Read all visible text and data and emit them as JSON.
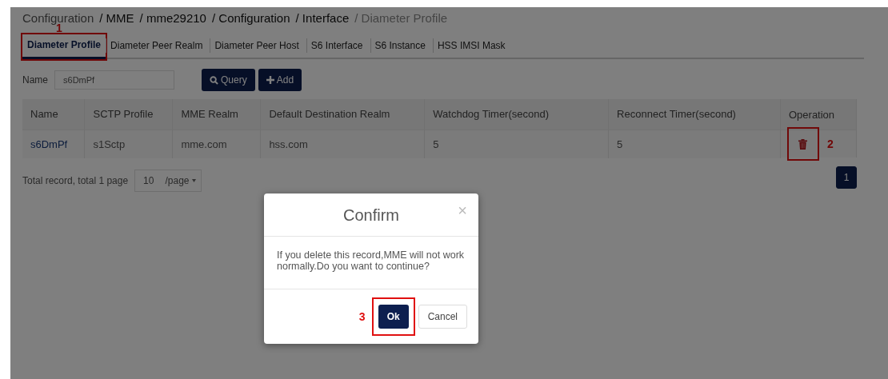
{
  "breadcrumb": [
    {
      "text": "Configuration",
      "current": false
    },
    {
      "text": "/ MME",
      "current": false
    },
    {
      "text": "/ mme29210",
      "current": false
    },
    {
      "text": "/ Configuration",
      "current": false
    },
    {
      "text": "/ Interface",
      "current": false
    },
    {
      "text": "/ Diameter Profile",
      "current": true
    }
  ],
  "tabs": [
    {
      "label": "Diameter Profile",
      "selected": true,
      "callout": "1"
    },
    {
      "label": "Diameter Peer Realm",
      "selected": false
    },
    {
      "label": "Diameter Peer Host",
      "selected": false
    },
    {
      "label": "S6 Interface",
      "selected": false
    },
    {
      "label": "S6 Instance",
      "selected": false
    },
    {
      "label": "HSS IMSI Mask",
      "selected": false
    }
  ],
  "filter": {
    "label": "Name",
    "value": "s6DmPf"
  },
  "buttons": [
    {
      "kind": "query",
      "label": "Query"
    },
    {
      "kind": "add",
      "label": "Add"
    }
  ],
  "table": {
    "columns": [
      "Name",
      "SCTP Profile",
      "MME Realm",
      "Default Destination Realm",
      "Watchdog Timer(second)",
      "Reconnect Timer(second)",
      "Operation"
    ],
    "rows": [
      {
        "cells": [
          "s6DmPf",
          "s1Sctp",
          "mme.com",
          "hss.com",
          "5",
          "5"
        ],
        "callout": "2"
      }
    ]
  },
  "pagination": {
    "summary": "Total record, total 1  page",
    "page_size": "10",
    "page_size_unit": "/page",
    "pages": [
      {
        "label": "1",
        "selected": true
      }
    ]
  },
  "dialog": {
    "title": "Confirm",
    "close": "×",
    "message": "If you delete this record,MME will not work normally.Do you want to continue?",
    "buttons": [
      {
        "kind": "primary",
        "label": "Ok",
        "callout": "3"
      },
      {
        "kind": "secondary",
        "label": "Cancel"
      }
    ]
  }
}
